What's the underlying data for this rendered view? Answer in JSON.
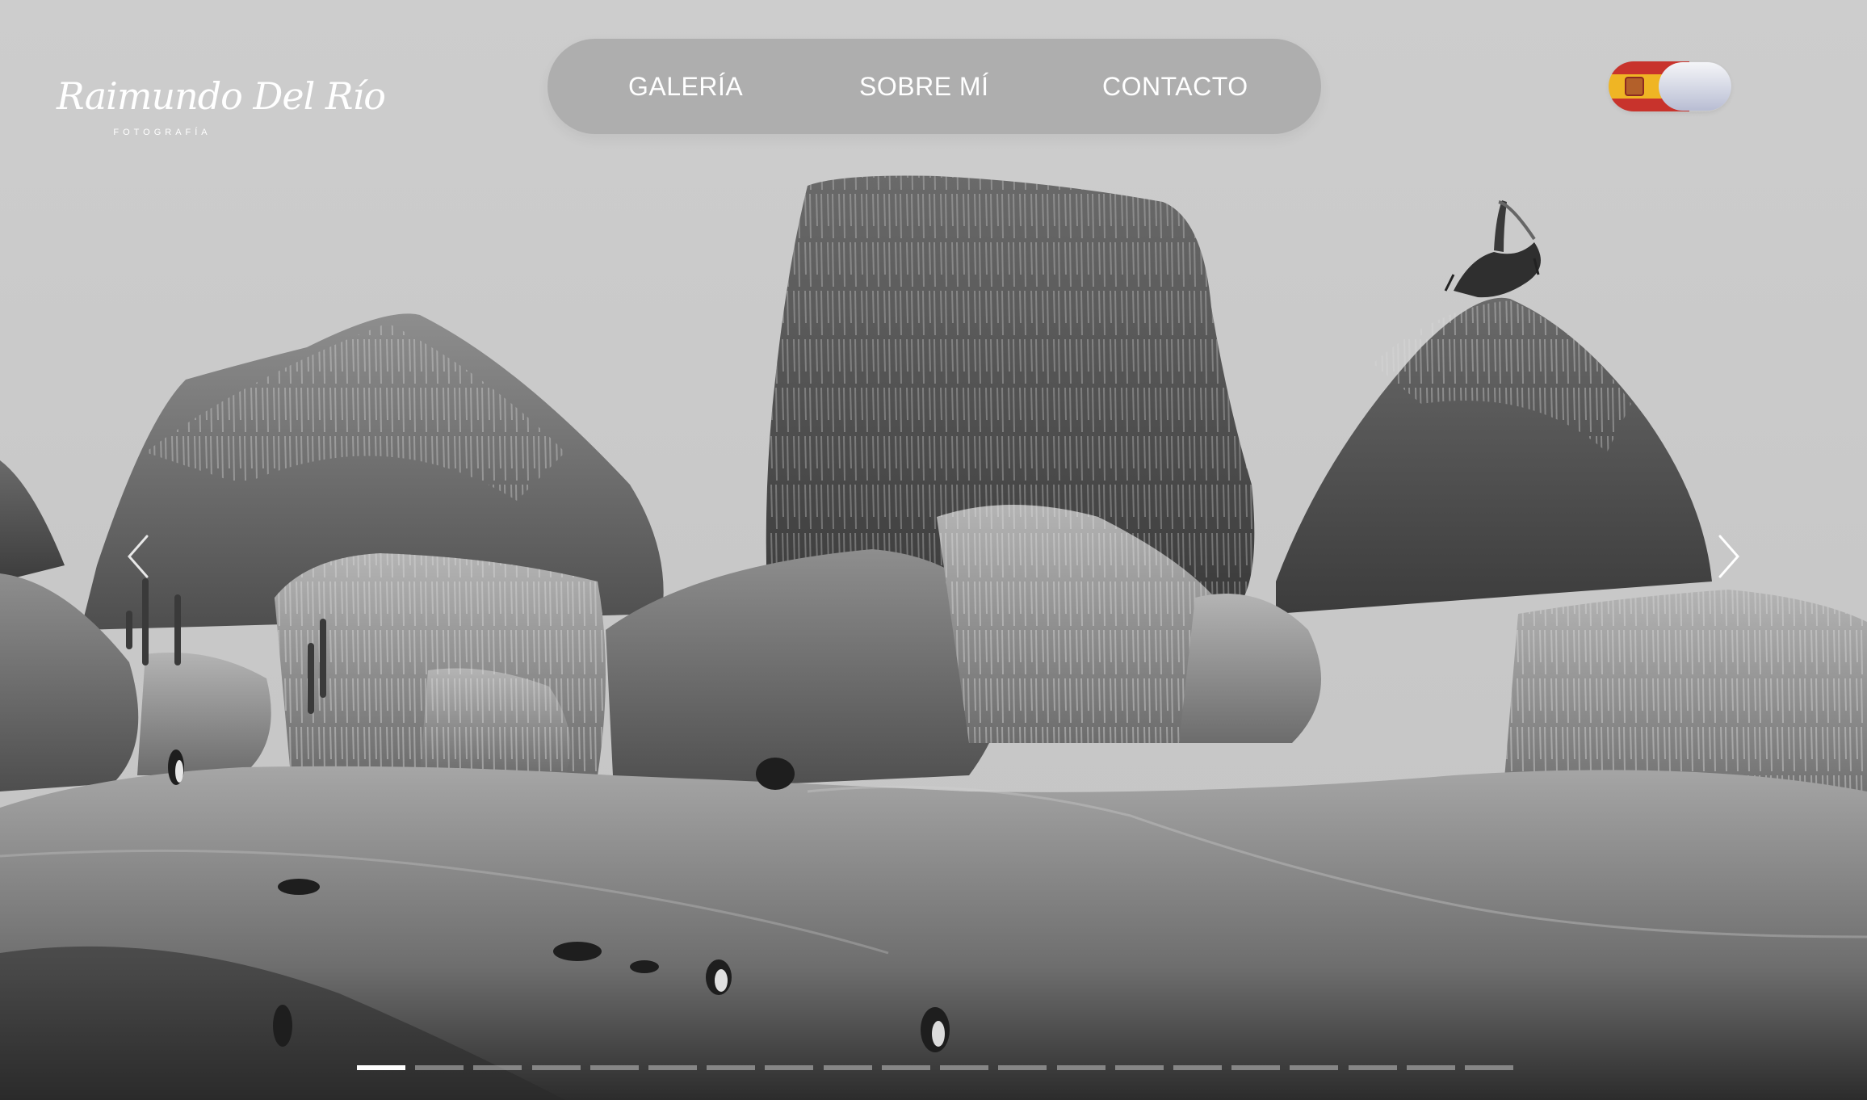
{
  "logo": {
    "script_text": "Raimundo Del Río",
    "subtitle": "FOTOGRAFÍA"
  },
  "nav": {
    "items": [
      {
        "label": "GALERÍA"
      },
      {
        "label": "SOBRE MÍ"
      },
      {
        "label": "CONTACTO"
      }
    ]
  },
  "language_toggle": {
    "selected_language": "Spanish",
    "flag": "spain-flag"
  },
  "carousel": {
    "slide_count": 20,
    "active_index": 0,
    "prev_icon": "chevron-left-icon",
    "next_icon": "chevron-right-icon"
  },
  "colors": {
    "sky": "#c9c9c9",
    "nav_background": "#a8a8a8",
    "text": "#ffffff"
  }
}
